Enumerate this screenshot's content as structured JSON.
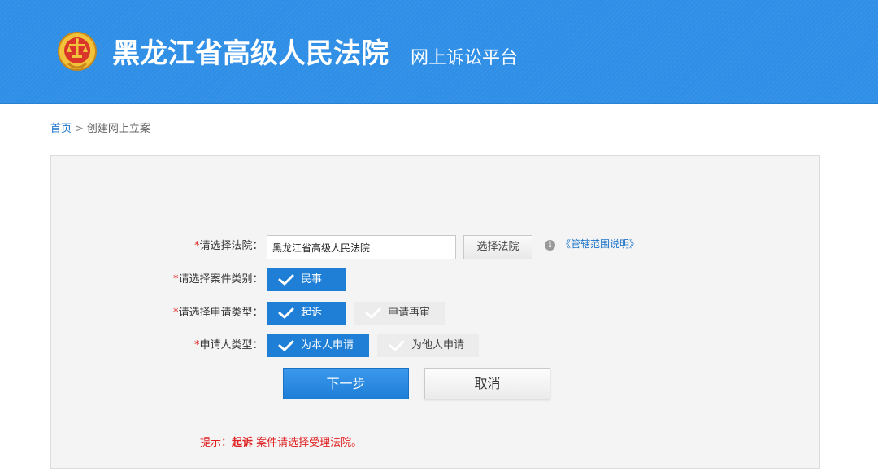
{
  "header": {
    "title": "黑龙江省高级人民法院",
    "subtitle": "网上诉讼平台",
    "emblem_icon": "court-emblem-icon",
    "background_color": "#2f8fe6"
  },
  "breadcrumb": {
    "home": "首页",
    "separator": ">",
    "current": "创建网上立案"
  },
  "form": {
    "required_mark": "*",
    "court": {
      "label": "请选择法院：",
      "value": "黑龙江省高级人民法院",
      "select_button": "选择法院",
      "info_icon": "info-icon",
      "jurisdiction_link": "《管辖范围说明》"
    },
    "case_category": {
      "label": "请选择案件类别：",
      "options": [
        {
          "label": "民事",
          "selected": true
        }
      ]
    },
    "application_type": {
      "label": "请选择申请类型：",
      "options": [
        {
          "label": "起诉",
          "selected": true
        },
        {
          "label": "申请再审",
          "selected": false
        }
      ]
    },
    "applicant_type": {
      "label": "申请人类型：",
      "options": [
        {
          "label": "为本人申请",
          "selected": true
        },
        {
          "label": "为他人申请",
          "selected": false
        }
      ]
    },
    "next_button": "下一步",
    "cancel_button": "取消",
    "hint": {
      "prefix": "提示：",
      "keyword": "起诉",
      "suffix": "案件请选择受理法院。"
    }
  },
  "colors": {
    "accent": "#1f7fd6",
    "required": "#e02020",
    "link": "#1a73c9"
  }
}
